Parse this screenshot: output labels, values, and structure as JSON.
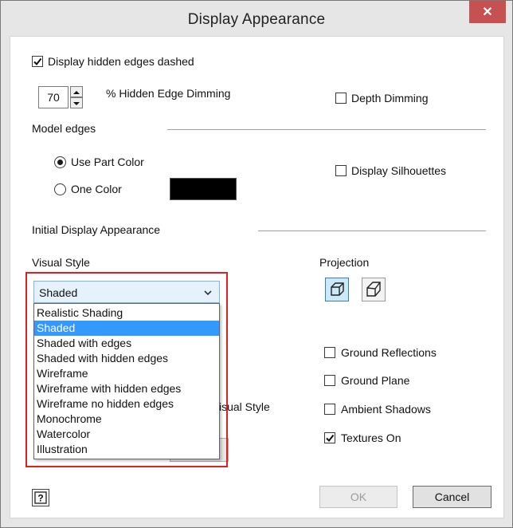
{
  "window": {
    "title": "Display Appearance",
    "close_glyph": "✕"
  },
  "hidden_edges": {
    "label": "Display hidden edges dashed",
    "checked": true
  },
  "dimming": {
    "value": "70",
    "label": "% Hidden Edge Dimming"
  },
  "depth_dimming": {
    "label": "Depth Dimming",
    "checked": false
  },
  "model_edges": {
    "section_label": "Model edges",
    "use_part_color": {
      "label": "Use Part Color",
      "selected": true
    },
    "one_color": {
      "label": "One Color",
      "selected": false
    },
    "swatch_color": "#000000"
  },
  "silhouettes": {
    "label": "Display Silhouettes",
    "checked": false
  },
  "initial_display": {
    "section_label": "Initial Display Appearance"
  },
  "visual_style": {
    "label": "Visual Style",
    "selected": "Shaded",
    "options": [
      "Realistic Shading",
      "Shaded",
      "Shaded with edges",
      "Shaded with hidden edges",
      "Wireframe",
      "Wireframe with hidden edges",
      "Wireframe no hidden edges",
      "Monochrome",
      "Watercolor",
      "Illustration"
    ],
    "selected_index": 1,
    "partial_label": "isual Style"
  },
  "projection": {
    "label": "Projection",
    "orthographic_icon": "orthographic-cube-icon",
    "perspective_icon": "perspective-cube-icon"
  },
  "options": {
    "ground_reflections": {
      "label": "Ground Reflections",
      "checked": false
    },
    "ground_plane": {
      "label": "Ground Plane",
      "checked": false
    },
    "ambient_shadows": {
      "label": "Ambient Shadows",
      "checked": false
    },
    "textures_on": {
      "label": "Textures On",
      "checked": true
    }
  },
  "buttons": {
    "help_glyph": "?",
    "ok": "OK",
    "cancel": "Cancel"
  },
  "colors": {
    "accent": "#3399ff",
    "highlight": "#e02020",
    "close": "#c75050"
  }
}
